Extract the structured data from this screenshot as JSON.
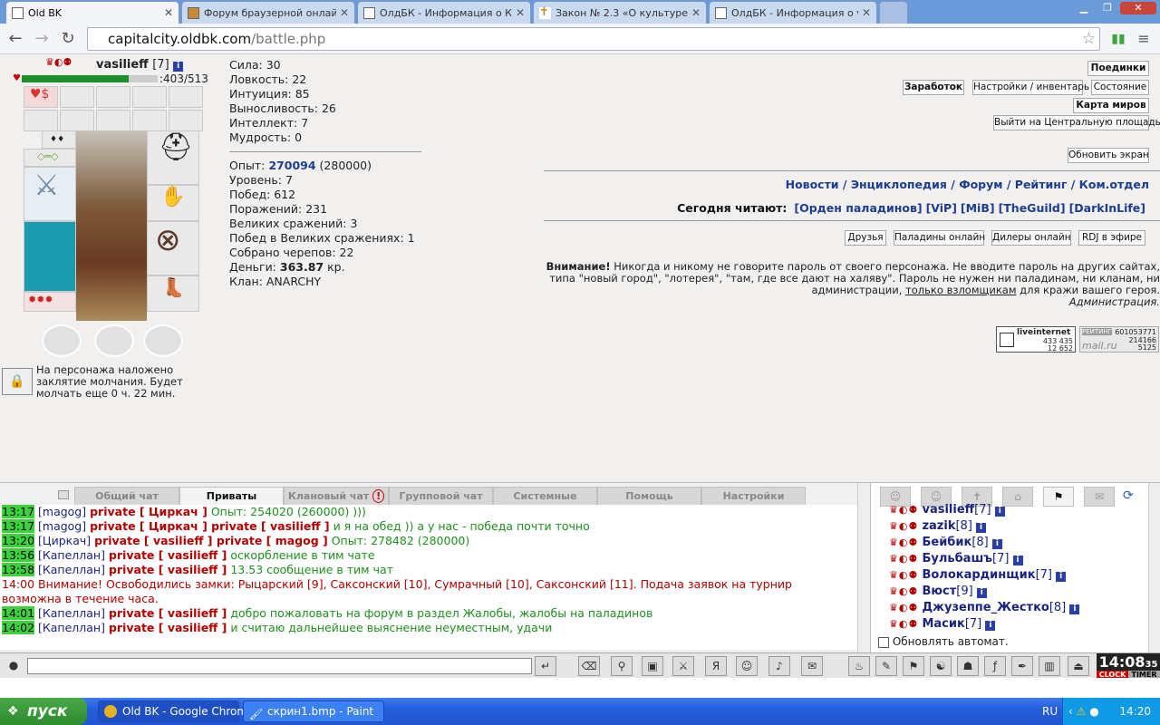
{
  "browser": {
    "tabs": [
      {
        "title": "Old BK"
      },
      {
        "title": "Форум браузерной онлайн и"
      },
      {
        "title": "ОлдБК - Информация о Кап"
      },
      {
        "title": "Закон № 2.3 «О культуре с"
      },
      {
        "title": "ОлдБК - Информация о vas"
      }
    ],
    "url_host": "capitalcity.oldbk.com",
    "url_path": "/battle.php"
  },
  "character": {
    "name": "vasilieff",
    "level": "[7]",
    "hp": ":403/513",
    "hp_fraction": 0.786,
    "stats": [
      {
        "label": "Сила:",
        "value": "30"
      },
      {
        "label": "Ловкость:",
        "value": "22"
      },
      {
        "label": "Интуиция:",
        "value": "85"
      },
      {
        "label": "Выносливость:",
        "value": "26"
      },
      {
        "label": "Интеллект:",
        "value": "7"
      },
      {
        "label": "Мудрость:",
        "value": "0"
      }
    ],
    "exp_label": "Опыт:",
    "exp_value": "270094",
    "exp_next": "(280000)",
    "level_label": "Уровень: 7",
    "wins": "Побед: 612",
    "losses": "Поражений: 231",
    "great_battles": "Великих сражений: 3",
    "great_wins": "Побед в Великих сражениях: 1",
    "skulls": "Собрано черепов: 22",
    "money_label": "Деньги:",
    "money_value": "363.87",
    "money_unit": "кр.",
    "clan": "Клан: ANARCHY",
    "silence": "На персонажа наложено заклятие молчания. Будет молчать еще 0 ч. 22 мин."
  },
  "right_panel": {
    "buttons": {
      "battles": "Поединки",
      "earnings": "Заработок",
      "settings": "Настройки / инвентарь",
      "state": "Состояние",
      "map": "Карта миров",
      "exit": "Выйти на Центральную площадь",
      "refresh": "Обновить экран"
    },
    "links": [
      "Новости",
      "Энциклопедия",
      "Форум",
      "Рейтинг",
      "Ком.отдел"
    ],
    "reading_label": "Сегодня читают:",
    "reading": [
      "[Орден паладинов]",
      "[ViP]",
      "[MiB]",
      "[TheGuild]",
      "[DarkInLife]"
    ],
    "friend_buttons": [
      "Друзья",
      "Паладины онлайн",
      "Дилеры онлайн",
      "RDJ в эфире"
    ],
    "warning_title": "Внимание!",
    "warning_text": "Никогда и никому не говорите пароль от своего персонажа. Не вводите пароль на других сайтах, типа \"новый город\", \"лотерея\", \"там, где все дают на халяву\". Пароль не нужен ни паладинам, ни кланам, ни администрации,",
    "warning_link": "только взломщикам",
    "warning_tail": "для кражи вашего героя.",
    "warning_sign": "Администрация.",
    "counter1": {
      "title": "liveinternet",
      "a": "433 435",
      "b": "12 652"
    },
    "counter2": {
      "title": "РЕЙТИНГ",
      "id": "601053771",
      "a": "214166",
      "b": "5125",
      "brand": "mail.ru"
    }
  },
  "chat": {
    "tabs": [
      "Общий чат",
      "Приваты",
      "Клановый чат",
      "Групповой чат",
      "Системные",
      "Помощь",
      "Настройки"
    ],
    "messages": [
      {
        "time": "13:17",
        "nick": "[magog]",
        "priv": "private [ Циркач ] private [ vasilieff ]",
        "text": "и я на обед )) а у нас - победа почти точно"
      },
      {
        "time": "13:20",
        "nick": "[Циркач]",
        "priv": "private [ vasilieff ] private [ magog ]",
        "text": "Опыт: 278482 (280000)"
      },
      {
        "time": "13:56",
        "nick": "[Капеллан]",
        "priv": "private [ vasilieff ]",
        "text": "оскорбление в тим чате"
      },
      {
        "time": "13:58",
        "nick": "[Капеллан]",
        "priv": "private [ vasilieff ]",
        "text": "13.53 сообщение в тим чат"
      },
      {
        "time": "14:01",
        "nick": "[Капеллан]",
        "priv": "private [ vasilieff ]",
        "text": "добро пожаловать на форум в раздел Жалобы, жалобы на паладинов"
      },
      {
        "time": "14:02",
        "nick": "[Капеллан]",
        "priv": "private [ vasilieff ]",
        "text": "и считаю дальнейшее выяснение неуместным, удачи"
      }
    ],
    "prev_line": {
      "time": "13:17",
      "nick": "[magog]",
      "priv": "private [ Циркач ]",
      "text": "Опыт: 254020 (260000) )))"
    },
    "system": {
      "time": "14:00",
      "text": "Внимание! Освободились замки: Рыцарский [9], Саксонский [10], Сумрачный [10], Саксонский [11]. Подача заявок на турнир возможна в течение часа."
    },
    "users": [
      {
        "name": "vasilieff",
        "level": "[7]"
      },
      {
        "name": "zazik",
        "level": "[8]"
      },
      {
        "name": "Бейбик",
        "level": "[8]"
      },
      {
        "name": "Бульбашъ",
        "level": "[7]"
      },
      {
        "name": "Волокардинщик",
        "level": "[7]"
      },
      {
        "name": "Вюст",
        "level": "[9]"
      },
      {
        "name": "Джузеппе_Жестко",
        "level": "[8]"
      },
      {
        "name": "Масик",
        "level": "[7]"
      }
    ],
    "auto_refresh": "Обновлять автомат.",
    "clock": "14:08",
    "clock_sec": "35",
    "clock_label": "CLOCK",
    "timer_label": "TIMER"
  },
  "taskbar": {
    "start": "пуск",
    "items": [
      "Old BK - Google Chrome",
      "скрин1.bmp - Paint"
    ],
    "lang": "RU",
    "time": "14:20"
  }
}
